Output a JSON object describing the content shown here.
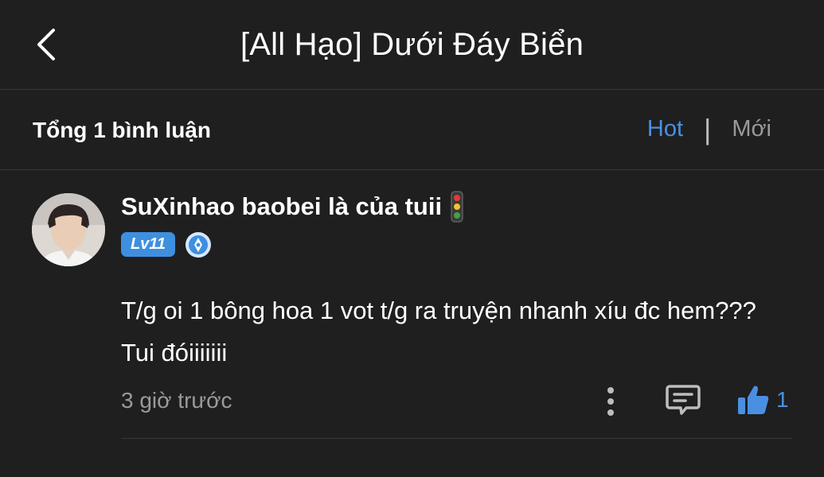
{
  "header": {
    "title": "[All Hạo] Dưới Đáy Biển"
  },
  "comments_bar": {
    "total_label": "Tổng 1 bình luận",
    "sort_hot": "Hot",
    "sort_separator": "|",
    "sort_new": "Mới",
    "active_sort": "Hot"
  },
  "comment": {
    "username": "SuXinhao baobei là của tuii",
    "level": "Lv11",
    "text": "T/g oi 1 bông hoa 1 vot t/g ra truyện nhanh xíu đc hem??? Tui đóiiiiiii",
    "time": "3 giờ trước",
    "like_count": "1"
  },
  "colors": {
    "background": "#1f1f1f",
    "accent": "#4a90e2",
    "muted": "#9a9a9a"
  },
  "icons": [
    "back-icon",
    "traffic-light-icon",
    "medal-icon",
    "more-icon",
    "reply-icon",
    "like-icon"
  ]
}
